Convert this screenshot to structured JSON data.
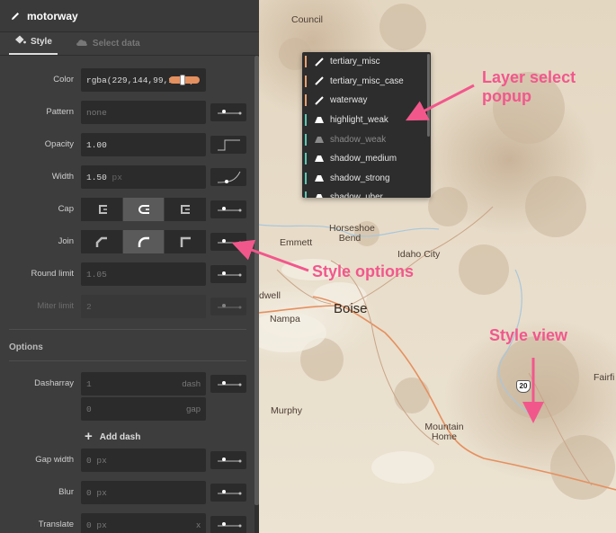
{
  "layer": {
    "name": "motorway",
    "accent": "#e8a16e"
  },
  "tabs": [
    {
      "label": "Style"
    },
    {
      "label": "Select data"
    }
  ],
  "fields": {
    "color": {
      "label": "Color",
      "value": "rgba(229,144,99,1.00)",
      "swatch": "#e5905f"
    },
    "pattern": {
      "label": "Pattern",
      "placeholder": "none"
    },
    "opacity": {
      "label": "Opacity",
      "value": "1.00"
    },
    "width": {
      "label": "Width",
      "value": "1.50",
      "unit": "px"
    },
    "cap": {
      "label": "Cap",
      "options": [
        "butt-cap-icon",
        "round-cap-icon",
        "square-cap-icon"
      ],
      "selected": 1
    },
    "join": {
      "label": "Join",
      "options": [
        "bevel-join-icon",
        "round-join-icon",
        "miter-join-icon"
      ],
      "selected": 1
    },
    "round_limit": {
      "label": "Round limit",
      "value": "1.05"
    },
    "miter_limit": {
      "label": "Miter limit",
      "value": "2"
    }
  },
  "options": {
    "heading": "Options",
    "dasharray": {
      "label": "Dasharray",
      "dash_value": "1",
      "dash_unit": "dash",
      "gap_value": "0",
      "gap_unit": "gap"
    },
    "add_dash": "Add dash",
    "gap_width": {
      "label": "Gap width",
      "value": "0",
      "unit": "px"
    },
    "blur": {
      "label": "Blur",
      "value": "0",
      "unit": "px"
    },
    "translate": {
      "label": "Translate",
      "value": "0",
      "unit": "px",
      "suffix": "x"
    }
  },
  "popup": {
    "items": [
      {
        "label": "tertiary_misc",
        "color": "#e8a16e",
        "icon": "line-icon"
      },
      {
        "label": "tertiary_misc_case",
        "color": "#e8a16e",
        "icon": "line-icon"
      },
      {
        "label": "waterway",
        "color": "#e8a16e",
        "icon": "line-icon"
      },
      {
        "label": "highlight_weak",
        "color": "#5cc8b0",
        "icon": "fill-icon"
      },
      {
        "label": "shadow_weak",
        "color": "#5cc8b0",
        "icon": "fill-icon",
        "dim": true
      },
      {
        "label": "shadow_medium",
        "color": "#5cc8b0",
        "icon": "fill-icon"
      },
      {
        "label": "shadow_strong",
        "color": "#5cc8b0",
        "icon": "fill-icon"
      },
      {
        "label": "shadow_uber",
        "color": "#5cc8b0",
        "icon": "fill-icon"
      }
    ]
  },
  "map": {
    "places": [
      "Council",
      "Horseshoe Bend",
      "Emmett",
      "Idaho City",
      "Boise",
      "Nampa",
      "dwell",
      "Murphy",
      "Mountain Home",
      "Fairfi"
    ],
    "shield": "20"
  },
  "annotations": {
    "popup": "Layer select\npopup",
    "options": "Style options",
    "view": "Style view",
    "color": "#f2578c"
  }
}
